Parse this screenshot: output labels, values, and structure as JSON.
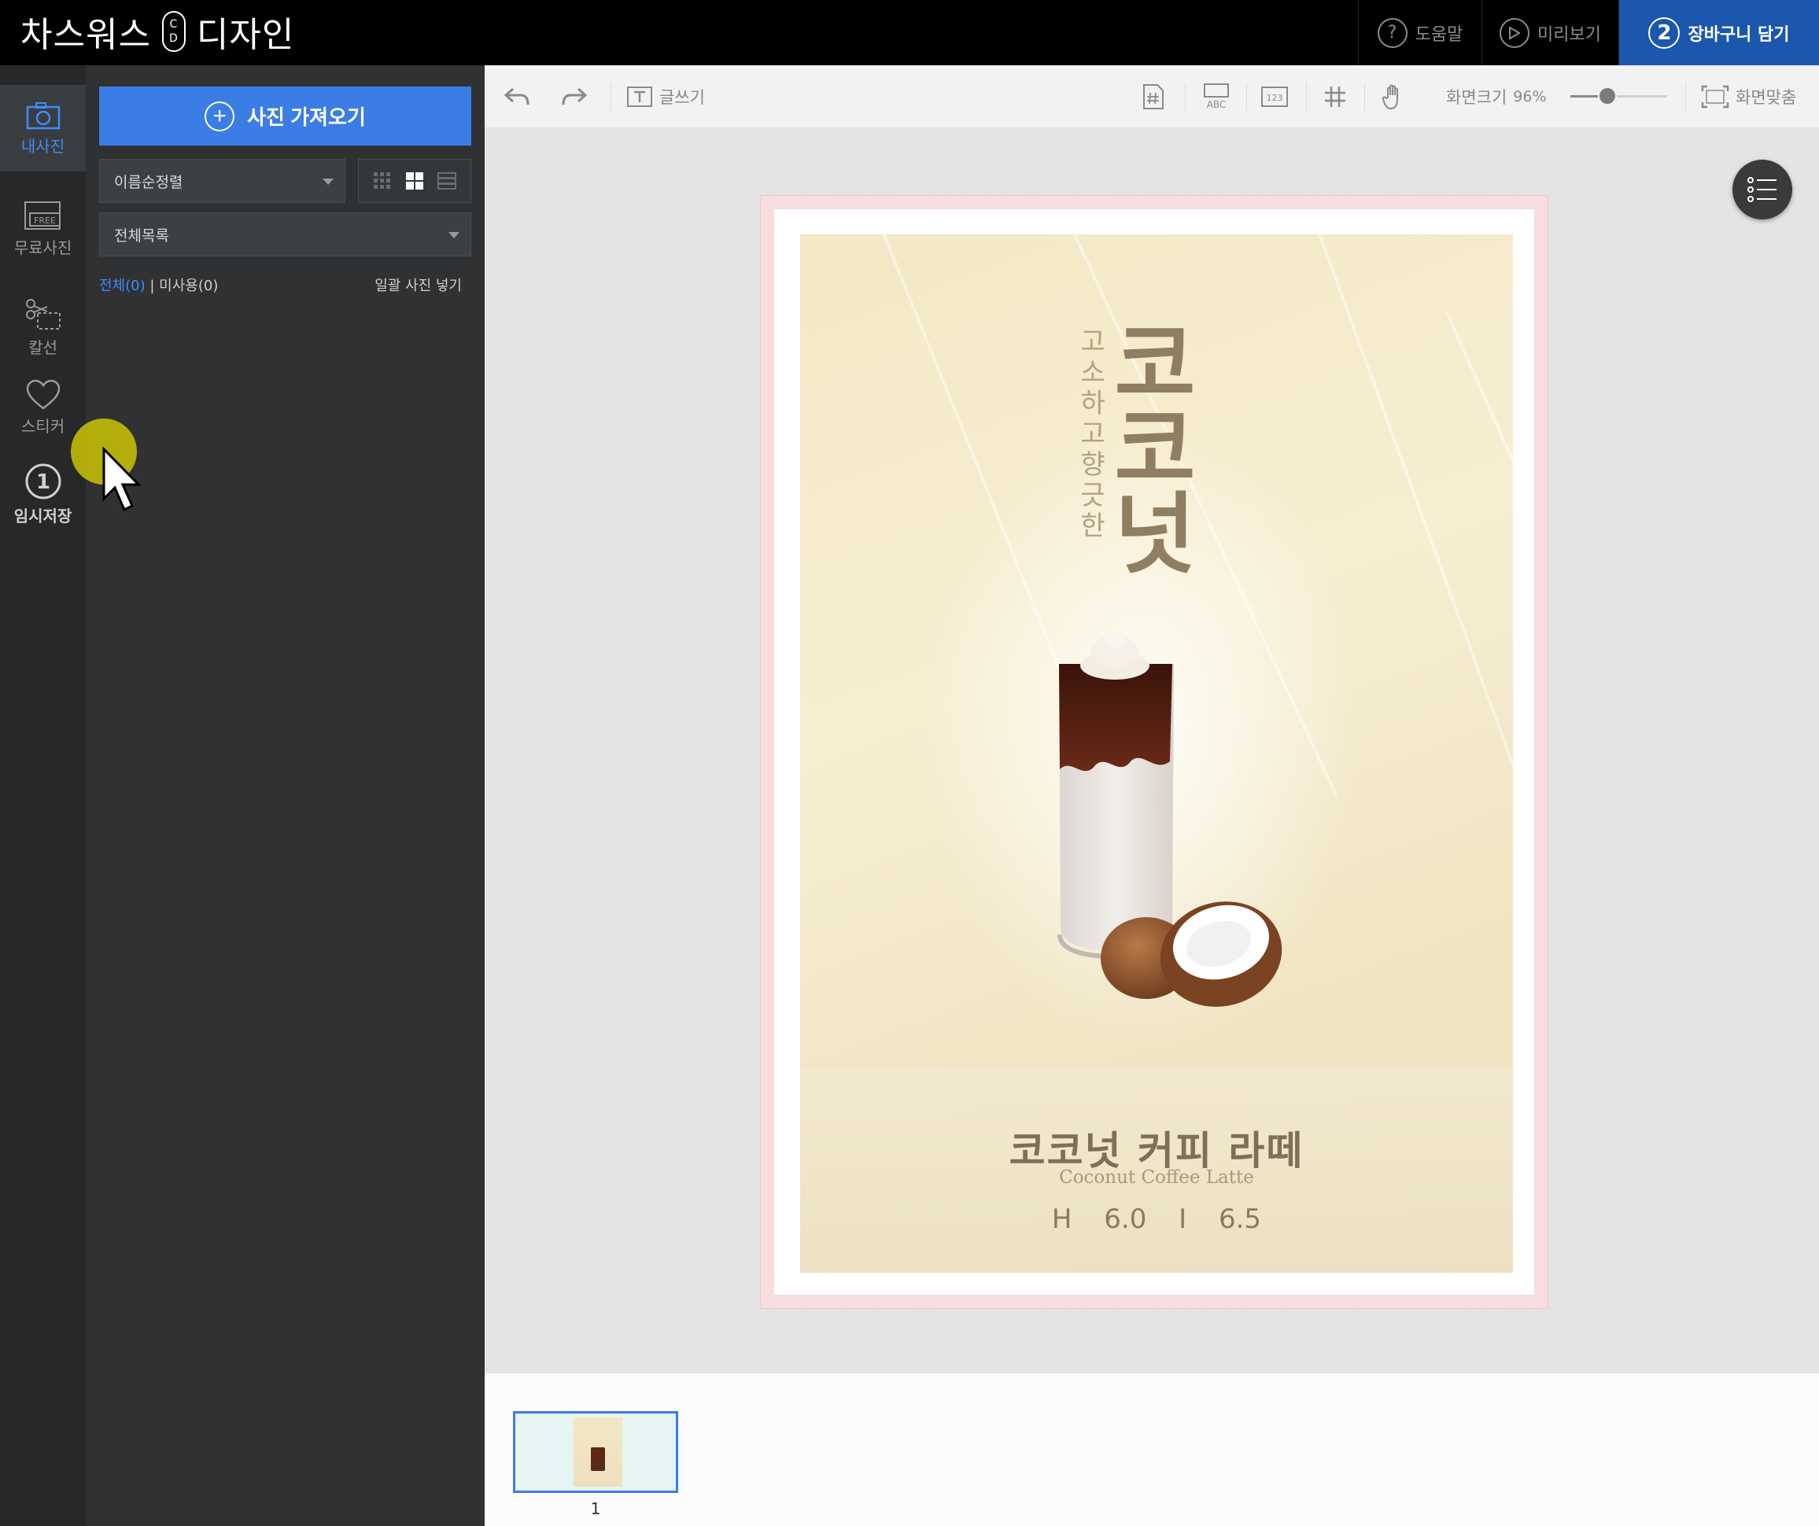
{
  "app": {
    "logo_left": "차스워스",
    "logo_mark": [
      "C",
      "D"
    ],
    "logo_right": "디자인"
  },
  "topbar": {
    "help": "도움말",
    "preview": "미리보기",
    "cart_step": "2",
    "cart": "장바구니 담기"
  },
  "rail": {
    "my_photos": "내사진",
    "free_photos": "무료사진",
    "free_badge": "FREE",
    "cutline": "칼선",
    "sticker": "스티커",
    "temp_save_step": "1",
    "temp_save": "임시저장"
  },
  "panel": {
    "import_button": "사진 가져오기",
    "sort_select": "이름순정렬",
    "folder_select": "전체목록",
    "filter_all": "전체(0)",
    "filter_sep": "|",
    "filter_unused": "미사용(0)",
    "bulk_insert": "일괄 사진 넣기"
  },
  "toolbar": {
    "write_text": "글쓰기",
    "abc_label": "ABC",
    "num_label": "123",
    "zoom_label": "화면크기",
    "zoom_value": "96%",
    "zoom_fraction": 0.38,
    "fit_screen": "화면맞춤"
  },
  "poster": {
    "subtitle_vertical": "고소하고 향긋한",
    "title_vertical": "코코넛",
    "name_ko": "코코넛 커피 라떼",
    "name_en": "Coconut Coffee Latte",
    "price": "H 6.0 I 6.5"
  },
  "pages": {
    "page_number": "1"
  },
  "colors": {
    "accent_blue": "#3b7de4",
    "cart_blue": "#1a57ad",
    "artboard_pink": "#f8dcdf",
    "poster_title": "#8f7e62"
  }
}
